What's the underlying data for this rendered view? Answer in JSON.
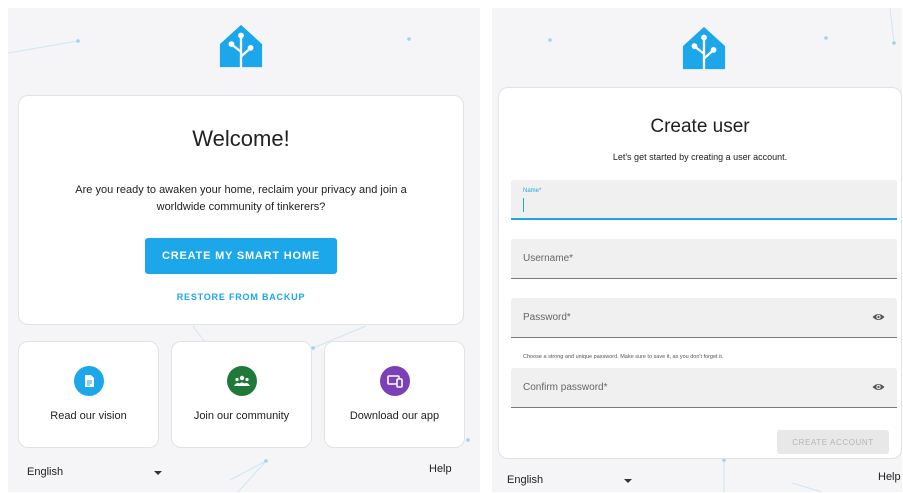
{
  "onboarding": {
    "welcome_title": "Welcome!",
    "welcome_text": "Are you ready to awaken your home, reclaim your privacy and join a worldwide community of tinkerers?",
    "create_button": "CREATE MY SMART HOME",
    "restore_button": "RESTORE FROM BACKUP",
    "tiles": [
      {
        "label": "Read our vision",
        "icon": "document-icon",
        "color": "#1ca7ea"
      },
      {
        "label": "Join our community",
        "icon": "community-icon",
        "color": "#1f7a3a"
      },
      {
        "label": "Download our app",
        "icon": "devices-icon",
        "color": "#7b3fb6"
      }
    ],
    "language": "English",
    "help": "Help"
  },
  "create_user": {
    "title": "Create user",
    "subtitle": "Let's get started by creating a user account.",
    "fields": {
      "name_label": "Name*",
      "username_label": "Username*",
      "password_label": "Password*",
      "password_helper": "Choose a strong and unique password. Make sure to save it, as you don't forget it.",
      "confirm_label": "Confirm password*"
    },
    "submit_button": "CREATE ACCOUNT",
    "language": "English",
    "help": "Help"
  },
  "colors": {
    "accent": "#1ca7ea",
    "background": "#f5f5f7"
  }
}
